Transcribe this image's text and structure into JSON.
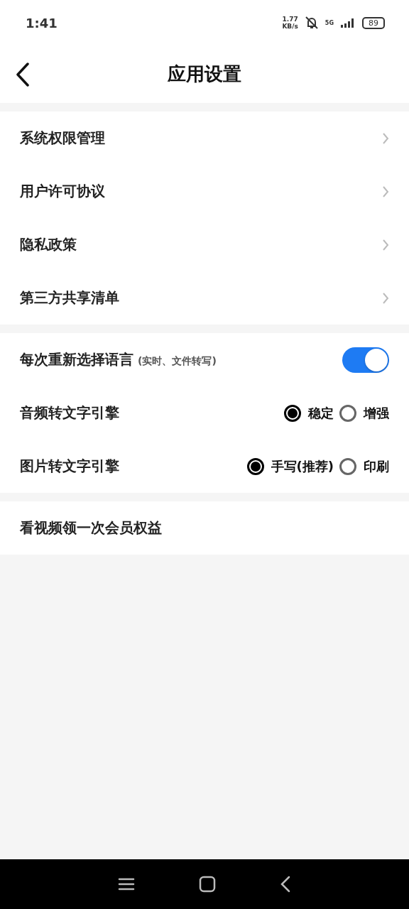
{
  "status_bar": {
    "time": "1:41",
    "speed_value": "1.77",
    "speed_unit": "KB/s",
    "network": "5G",
    "battery": "89"
  },
  "header": {
    "title": "应用设置"
  },
  "link_items": [
    {
      "label": "系统权限管理"
    },
    {
      "label": "用户许可协议"
    },
    {
      "label": "隐私政策"
    },
    {
      "label": "第三方共享清单"
    }
  ],
  "toggle_row": {
    "label": "每次重新选择语言",
    "hint": "(实时、文件转写)",
    "on": true
  },
  "radio_rows": [
    {
      "label": "音频转文字引擎",
      "options": [
        {
          "label": "稳定",
          "selected": true
        },
        {
          "label": "增强",
          "selected": false
        }
      ]
    },
    {
      "label": "图片转文字引擎",
      "options": [
        {
          "label": "手写(推荐)",
          "selected": true
        },
        {
          "label": "印刷",
          "selected": false
        }
      ]
    }
  ],
  "extra_item": {
    "label": "看视频领一次会员权益"
  }
}
